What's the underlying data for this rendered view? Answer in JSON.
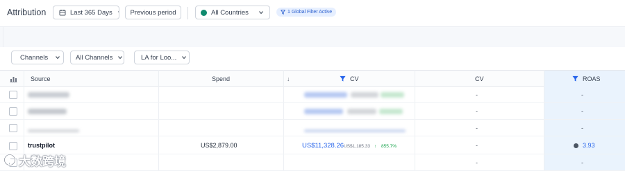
{
  "header": {
    "title": "Attribution",
    "date_range": "Last 365 Days",
    "compare": "Previous period",
    "country": "All Countries",
    "filter_badge": "1 Global Filter Active"
  },
  "table_filters": {
    "group_by": "Channels",
    "channels": "All Channels",
    "model": "LA for Loo..."
  },
  "table": {
    "columns": {
      "source": "Source",
      "spend": "Spend",
      "sort_arrow": "↓",
      "cv_filtered": "CV",
      "cv": "CV",
      "roas": "ROAS"
    },
    "rows": [
      {
        "source": "",
        "spend": "",
        "cv_value": "",
        "cv": "-",
        "roas": "-"
      },
      {
        "source": "",
        "spend": "",
        "cv_value": "",
        "cv": "-",
        "roas": "-"
      },
      {
        "source": "",
        "spend": "",
        "cv_value": "",
        "cv": "-",
        "roas": "-"
      },
      {
        "source": "trustpilot",
        "spend": "US$2,879.00",
        "cv_value": "US$11,328.26",
        "cv_prev": "US$1,185.33",
        "cv_change": "855.7%",
        "cv": "-",
        "roas": "3.93"
      },
      {
        "source": "",
        "spend": "",
        "cv_value": "",
        "cv": "-",
        "roas": "-"
      }
    ]
  },
  "watermark": {
    "text": "大数跨境"
  },
  "colors": {
    "accent_blue": "#2563eb",
    "positive_green": "#16a34a",
    "roas_column_bg": "#eaf3fd",
    "badge_bg": "#e6efff"
  }
}
